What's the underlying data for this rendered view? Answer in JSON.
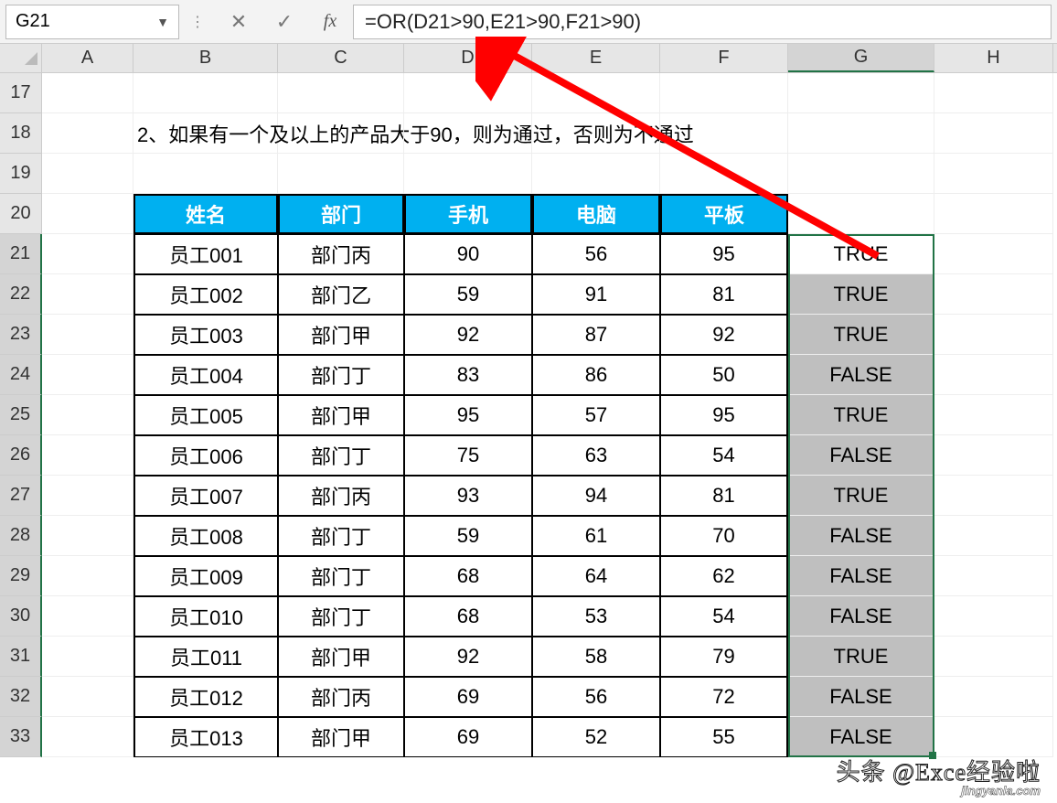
{
  "formula_bar": {
    "cell_ref": "G21",
    "formula": "=OR(D21>90,E21>90,F21>90)"
  },
  "columns": [
    "A",
    "B",
    "C",
    "D",
    "E",
    "F",
    "G",
    "H"
  ],
  "row_numbers": [
    17,
    18,
    19,
    20,
    21,
    22,
    23,
    24,
    25,
    26,
    27,
    28,
    29,
    30,
    31,
    32,
    33
  ],
  "instruction": "2、如果有一个及以上的产品大于90，则为通过，否则为不通过",
  "table": {
    "headers": [
      "姓名",
      "部门",
      "手机",
      "电脑",
      "平板"
    ],
    "rows": [
      {
        "name": "员工001",
        "dept": "部门丙",
        "ph": "90",
        "pc": "56",
        "tab": "95",
        "res": "TRUE"
      },
      {
        "name": "员工002",
        "dept": "部门乙",
        "ph": "59",
        "pc": "91",
        "tab": "81",
        "res": "TRUE"
      },
      {
        "name": "员工003",
        "dept": "部门甲",
        "ph": "92",
        "pc": "87",
        "tab": "92",
        "res": "TRUE"
      },
      {
        "name": "员工004",
        "dept": "部门丁",
        "ph": "83",
        "pc": "86",
        "tab": "50",
        "res": "FALSE"
      },
      {
        "name": "员工005",
        "dept": "部门甲",
        "ph": "95",
        "pc": "57",
        "tab": "95",
        "res": "TRUE"
      },
      {
        "name": "员工006",
        "dept": "部门丁",
        "ph": "75",
        "pc": "63",
        "tab": "54",
        "res": "FALSE"
      },
      {
        "name": "员工007",
        "dept": "部门丙",
        "ph": "93",
        "pc": "94",
        "tab": "81",
        "res": "TRUE"
      },
      {
        "name": "员工008",
        "dept": "部门丁",
        "ph": "59",
        "pc": "61",
        "tab": "70",
        "res": "FALSE"
      },
      {
        "name": "员工009",
        "dept": "部门丁",
        "ph": "68",
        "pc": "64",
        "tab": "62",
        "res": "FALSE"
      },
      {
        "name": "员工010",
        "dept": "部门丁",
        "ph": "68",
        "pc": "53",
        "tab": "54",
        "res": "FALSE"
      },
      {
        "name": "员工011",
        "dept": "部门甲",
        "ph": "92",
        "pc": "58",
        "tab": "79",
        "res": "TRUE"
      },
      {
        "name": "员工012",
        "dept": "部门丙",
        "ph": "69",
        "pc": "56",
        "tab": "72",
        "res": "FALSE"
      },
      {
        "name": "员工013",
        "dept": "部门甲",
        "ph": "69",
        "pc": "52",
        "tab": "55",
        "res": "FALSE"
      }
    ]
  },
  "watermark": {
    "line1": "头条 @Exce经验啦",
    "line2": "jingyanla.com"
  }
}
